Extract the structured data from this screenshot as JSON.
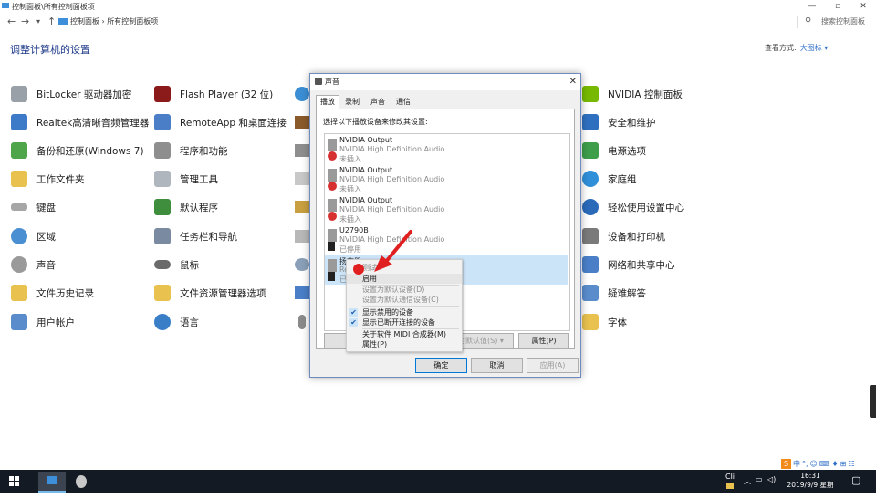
{
  "window": {
    "title": "控制面板\\所有控制面板项",
    "minimize": "—",
    "maximize": "▫",
    "close": "✕"
  },
  "nav": {
    "back": "←",
    "forward": "→",
    "dropdown": "▾",
    "up": "↑",
    "address": "控制面板 › 所有控制面板项",
    "search_placeholder": "搜索控制面板"
  },
  "heading": "调整计算机的设置",
  "view_by": {
    "label": "查看方式:",
    "value": "大图标 ▾"
  },
  "items_col1": [
    "BitLocker 驱动器加密",
    "Realtek高清晰音频管理器",
    "备份和还原(Windows 7)",
    "工作文件夹",
    "键盘",
    "区域",
    "声音",
    "文件历史记录",
    "用户帐户"
  ],
  "items_col2": [
    "Flash Player (32 位)",
    "RemoteApp 和桌面连接",
    "程序和功能",
    "管理工具",
    "默认程序",
    "任务栏和导航",
    "鼠标",
    "文件资源管理器选项",
    "语言"
  ],
  "items_col4": [
    "NVIDIA 控制面板",
    "安全和维护",
    "电源选项",
    "家庭组",
    "轻松使用设置中心",
    "设备和打印机",
    "网络和共享中心",
    "疑难解答",
    "字体"
  ],
  "dialog": {
    "title": "声音",
    "close": "✕",
    "tabs": [
      "播放",
      "录制",
      "声音",
      "通信"
    ],
    "instruction": "选择以下播放设备来修改其设置:",
    "devices": [
      {
        "name": "NVIDIA Output",
        "driver": "NVIDIA High Definition Audio",
        "status": "未插入"
      },
      {
        "name": "NVIDIA Output",
        "driver": "NVIDIA High Definition Audio",
        "status": "未插入"
      },
      {
        "name": "NVIDIA Output",
        "driver": "NVIDIA High Definition Audio",
        "status": "未插入"
      },
      {
        "name": "U2790B",
        "driver": "NVIDIA High Definition Audio",
        "status": "已停用"
      },
      {
        "name": "扬声器",
        "driver": "Re",
        "status": "已"
      }
    ],
    "configure_button": "配",
    "set_default_button": "为默认值(S) ▾",
    "properties_button": "属性(P)",
    "ok": "确定",
    "cancel": "取消",
    "apply": "应用(A)"
  },
  "context_menu": {
    "test": "测试",
    "enable": "启用",
    "set_default": "设置为默认设备(D)",
    "set_default_comm": "设置为默认通信设备(C)",
    "show_disabled": "显示禁用的设备",
    "show_disconnected": "显示已断开连接的设备",
    "about_midi": "关于软件 MIDI 合成器(M)",
    "properties": "属性(P)"
  },
  "taskbar": {
    "clock_time": "16:31",
    "clock_date": "2019/9/9 星期一",
    "tray_lang": "Cli",
    "ime": [
      "中",
      "°,",
      "☺",
      "⌨",
      "♦",
      "⊞",
      "☷"
    ]
  },
  "colors": {
    "accent": "#0078d7",
    "taskbar": "#141a24",
    "selection": "#cce4f7"
  }
}
